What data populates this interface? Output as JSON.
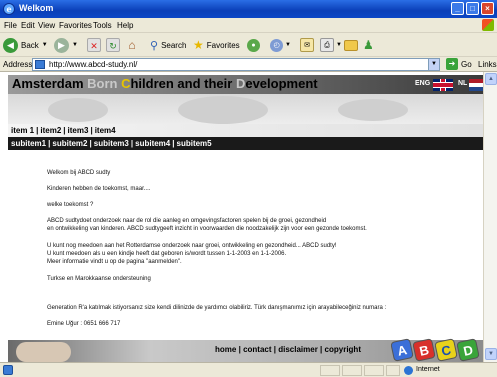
{
  "window": {
    "title": "Welkom",
    "buttons": [
      "_",
      "□",
      "×"
    ]
  },
  "menu": [
    "File",
    "Edit",
    "View",
    "Favorites",
    "Tools",
    "Help"
  ],
  "toolbar": {
    "back": "Back",
    "search": "Search",
    "favorites": "Favorites"
  },
  "address": {
    "label": "Address",
    "url": "http://www.abcd-study.nl/",
    "go": "Go",
    "links": "Links"
  },
  "site": {
    "title_parts": [
      "Amsterdam ",
      "Born ",
      "C",
      "hildren and their ",
      "D",
      "evelopment"
    ],
    "lang_eng": "ENG",
    "lang_nl": "NL",
    "nav1": [
      "item 1",
      "item2",
      "item3",
      "item4"
    ],
    "nav2": [
      "subitem1",
      "subitem2",
      "subitem3",
      "subitem4",
      "subitem5"
    ],
    "separator": "|"
  },
  "content": {
    "lines": [
      "Welkom bij ABCD sudty",
      "Kinderen hebben de toekomst, maar....",
      "welke toekomst ?",
      "ABCD sudtydoet onderzoek naar de rol die aanleg en omgevingsfactoren spelen bij de groei, gezondheid",
      "en ontwikkeling van kinderen. ABCD sudtygeeft inzicht in voorwaarden die noodzakelijk zijn voor een gezonde toekomst.",
      "U kunt nog meedoen aan het Rotterdamse onderzoek naar groei, ontwikkeling en gezondheid... ABCD sudty!",
      "U kunt meedoen als u een kindje heeft dat geboren is/wordt tussen 1-1-2003 en 1-1-2006.",
      "Meer informatie vindt u op de pagina \"aanmelden\".",
      "Turkse en Marokkaanse ondersteuning",
      "Generation R'a katılmak istiyorsanız size kendi dilinizde de yardımcı olabiliriz. Türk danışmanımız için arayabileceğiniz numara :",
      "Emine Uğur : 0651 666 717"
    ]
  },
  "footer": {
    "links": [
      "home",
      "contact",
      "disclaimer",
      "copyright"
    ],
    "logo_letters": [
      "A",
      "B",
      "C",
      "D"
    ]
  },
  "status": {
    "zone": "Internet"
  },
  "colors": {
    "titlebar": "#0a3fb8",
    "nav_dark": "#1a1a1a",
    "logo_a": "#3b6fd8",
    "logo_b": "#d8312b",
    "logo_c": "#e8d21a",
    "logo_d": "#3aa43a"
  }
}
